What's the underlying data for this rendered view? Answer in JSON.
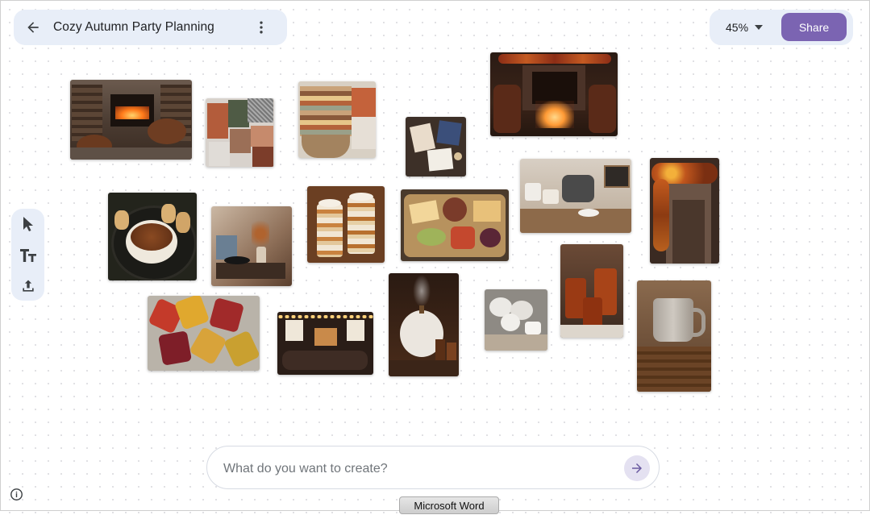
{
  "header": {
    "title": "Cozy Autumn Party Planning",
    "back_icon": "arrow-back-icon",
    "more_icon": "more-vert-icon"
  },
  "toolbar": {
    "zoom": "45%",
    "share_label": "Share"
  },
  "tools": [
    "select-tool",
    "text-tool",
    "upload-tool"
  ],
  "canvas": {
    "images": [
      "fireplace-lounge-image",
      "fabric-swatches-image",
      "folded-blankets-image",
      "board-games-image",
      "candlelit-fireplace-image",
      "baked-brie-image",
      "vinyl-record-player-image",
      "dessert-parfaits-image",
      "charcuterie-board-image",
      "hot-cocoa-bar-image",
      "autumn-garland-door-image",
      "autumn-leaves-image",
      "cozy-living-room-image",
      "white-pumpkin-diffuser-image",
      "white-pumpkins-tea-image",
      "mulled-cider-image",
      "ceramic-mug-image"
    ]
  },
  "prompt": {
    "placeholder": "What do you want to create?"
  },
  "tooltip": {
    "text": "Microsoft Word"
  },
  "colors": {
    "accent": "#7b64b2",
    "panel": "#e8eef8",
    "send_bg": "#e4e1f1"
  }
}
